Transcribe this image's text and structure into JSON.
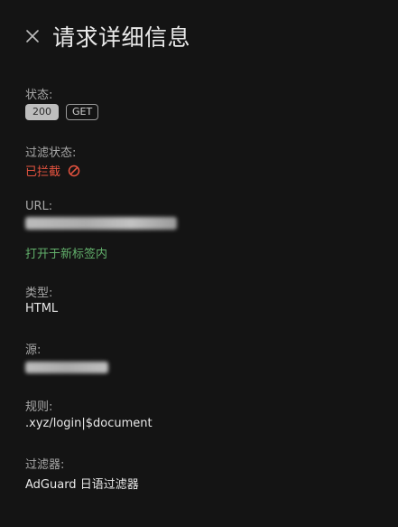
{
  "header": {
    "title": "请求详细信息"
  },
  "status": {
    "label": "状态:",
    "code": "200",
    "method": "GET"
  },
  "filter_status": {
    "label": "过滤状态:",
    "value": "已拦截",
    "icon": "blocked-icon",
    "color": "#e5533f"
  },
  "url": {
    "label": "URL:",
    "open_link": "打开于新标签内",
    "link_color": "#62b06b"
  },
  "type": {
    "label": "类型:",
    "value": "HTML"
  },
  "source": {
    "label": "源:"
  },
  "rule": {
    "label": "规则:",
    "value": ".xyz/login|$document"
  },
  "filter": {
    "label": "过滤器:",
    "value": "AdGuard 日语过滤器"
  }
}
